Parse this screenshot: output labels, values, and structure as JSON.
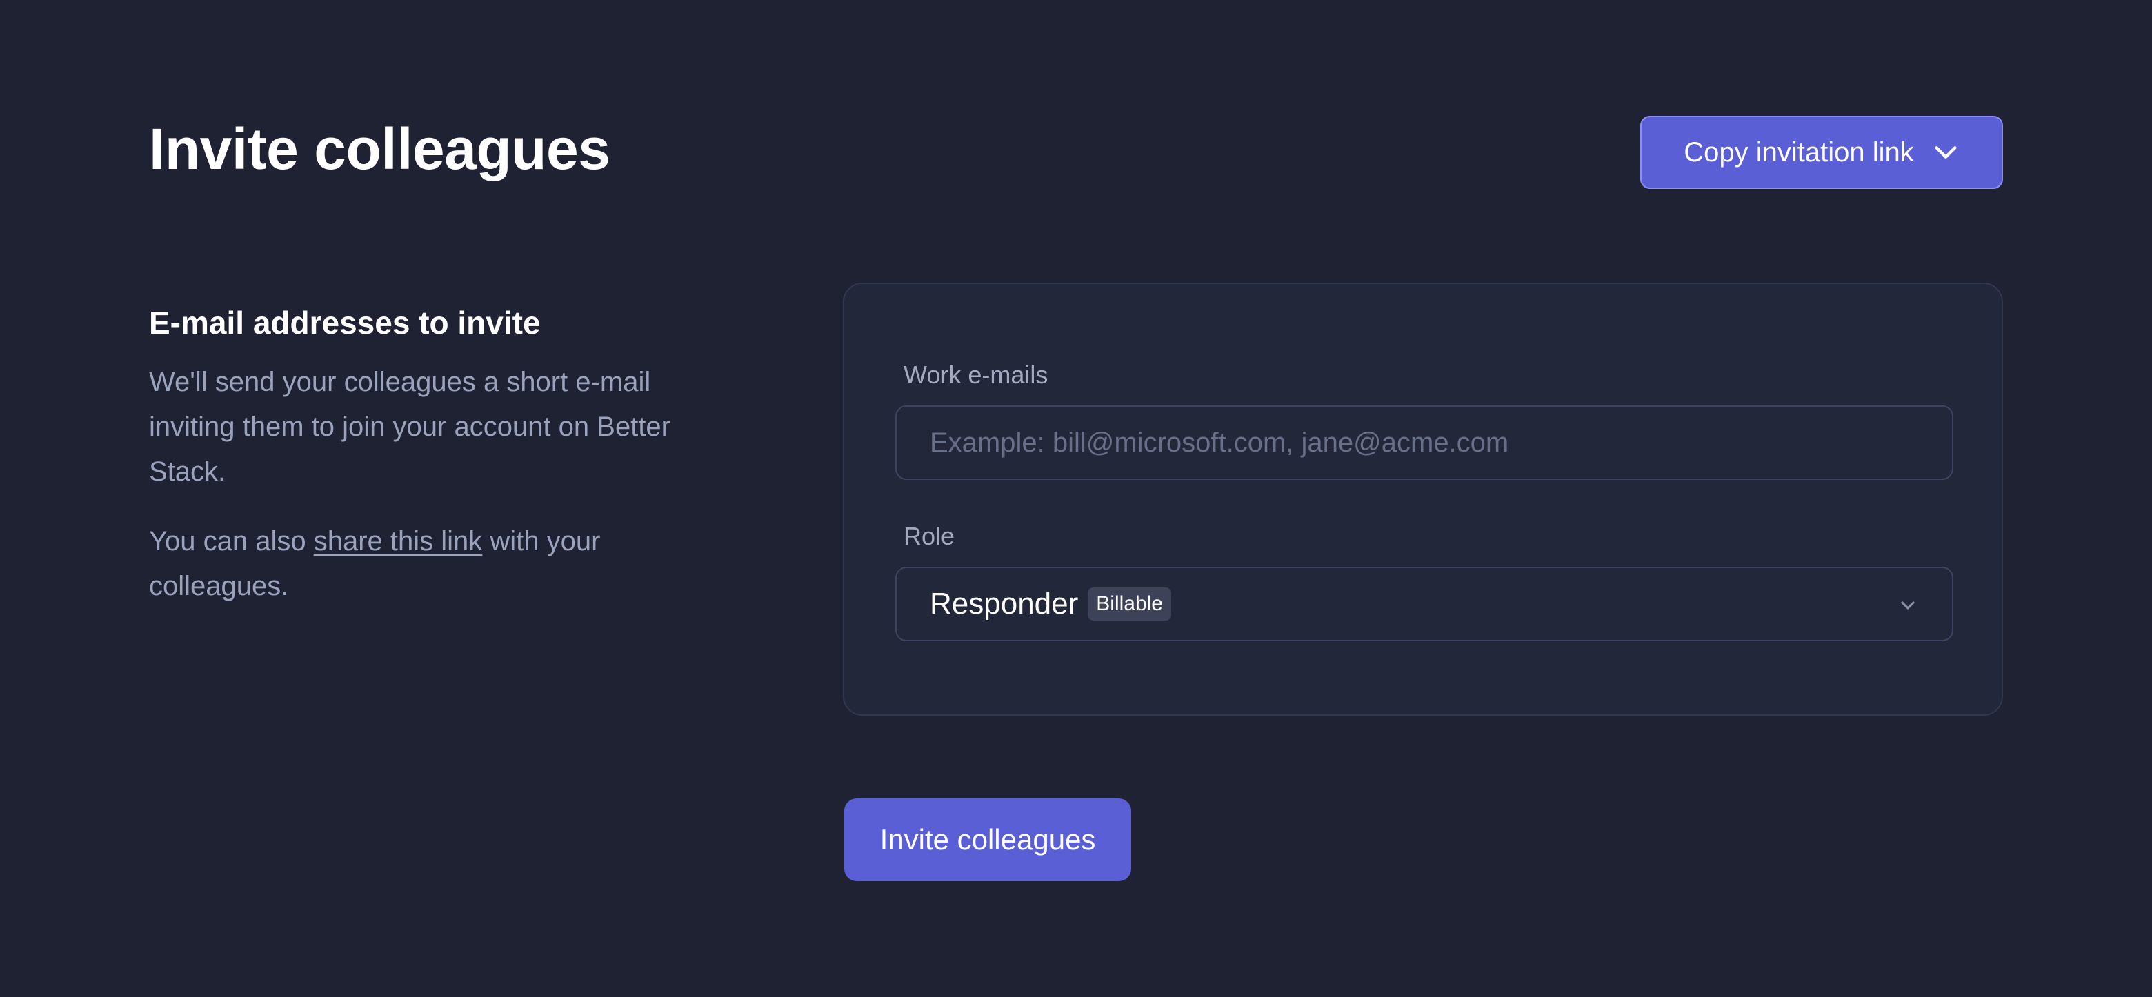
{
  "header": {
    "title": "Invite colleagues",
    "copy_link_label": "Copy invitation link",
    "copy_link_icon": "chevron-down-icon"
  },
  "intro": {
    "heading": "E-mail addresses to invite",
    "paragraph1": "We'll send your colleagues a short e-mail inviting them to join your account on Better Stack.",
    "paragraph2_before": "You can also ",
    "paragraph2_link": "share this link",
    "paragraph2_after": " with your colleagues."
  },
  "form": {
    "emails_label": "Work e-mails",
    "emails_value": "",
    "emails_placeholder": "Example: bill@microsoft.com, jane@acme.com",
    "role_label": "Role",
    "role_value": "Responder",
    "role_badge": "Billable",
    "role_icon": "chevron-down-icon"
  },
  "actions": {
    "invite_label": "Invite colleagues"
  },
  "colors": {
    "background": "#1e2233",
    "card": "#23273a",
    "accent": "#5b5fd6",
    "muted_text": "#9ba2bb"
  }
}
